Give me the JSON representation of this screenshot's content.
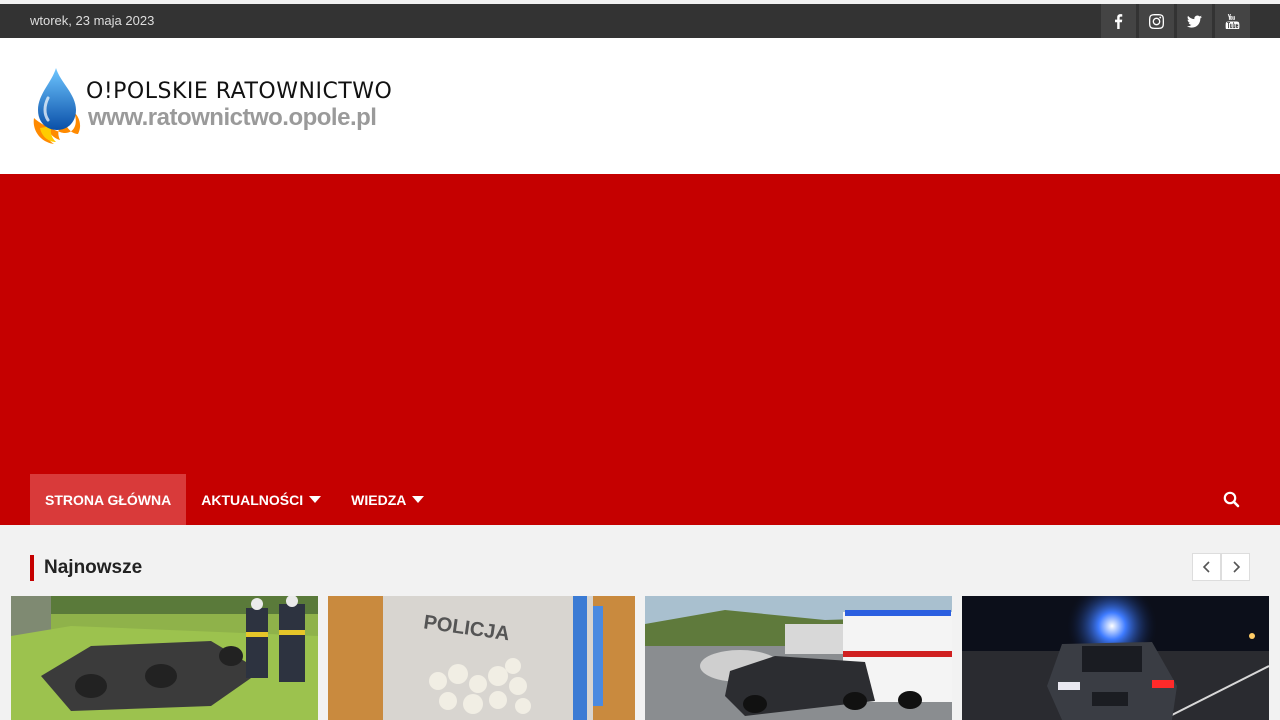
{
  "topbar": {
    "date": "wtorek, 23 maja 2023",
    "social": [
      "facebook-icon",
      "instagram-icon",
      "twitter-icon",
      "youtube-icon"
    ]
  },
  "logo": {
    "title": "O!POLSKIE RATOWNICTWO",
    "url": "www.ratownictwo.opole.pl"
  },
  "nav": {
    "items": [
      {
        "label": "STRONA GŁÓWNA",
        "active": true
      },
      {
        "label": "AKTUALNOŚCI",
        "dropdown": true
      },
      {
        "label": "WIEDZA",
        "dropdown": true
      }
    ]
  },
  "latest": {
    "title": "Najnowsze"
  },
  "colors": {
    "brand_red": "#c50000",
    "active_red": "#d93a3a",
    "topbar": "#333333"
  }
}
